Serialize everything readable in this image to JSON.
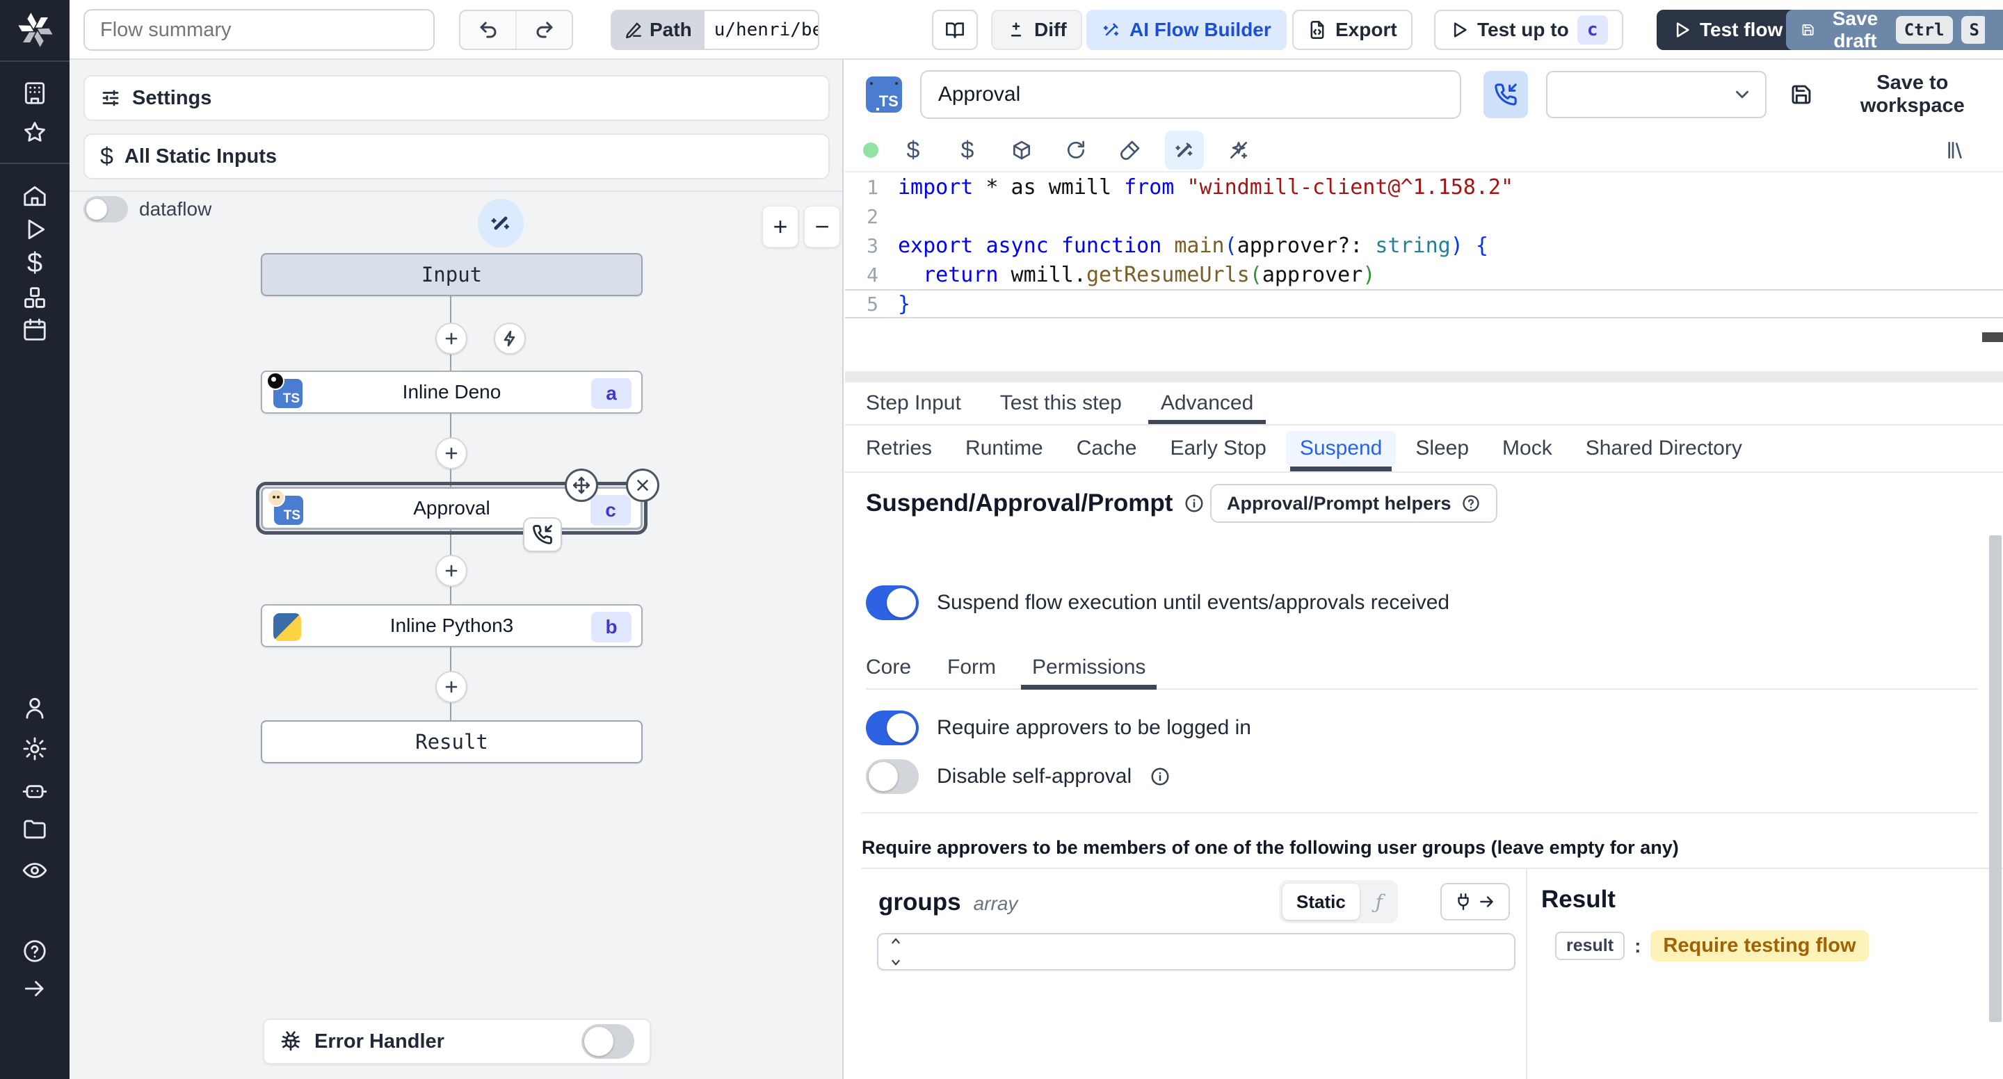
{
  "topbar": {
    "flow_summary_placeholder": "Flow summary",
    "path_label": "Path",
    "path_value": "u/henri/bes",
    "diff_label": "Diff",
    "ai_flow_builder_label": "AI Flow Builder",
    "export_label": "Export",
    "test_up_to_label": "Test up to",
    "test_up_to_badge": "c",
    "test_flow_label": "Test flow",
    "save_draft_label": "Save draft",
    "save_draft_keys": [
      "Ctrl",
      "S"
    ]
  },
  "flow_panel": {
    "settings_label": "Settings",
    "static_inputs_label": "All Static Inputs",
    "dataflow_label": "dataflow",
    "nodes": {
      "input_label": "Input",
      "deno_label": "Inline Deno",
      "deno_badge": "a",
      "approval_label": "Approval",
      "approval_badge": "c",
      "python_label": "Inline Python3",
      "python_badge": "b",
      "result_label": "Result"
    },
    "error_handler_label": "Error Handler"
  },
  "step_editor": {
    "language_badge": "TS",
    "name_value": "Approval",
    "save_to_workspace_label": "Save to workspace",
    "lines": [
      {
        "n": "1",
        "tokens": [
          [
            "kw",
            "import"
          ],
          [
            "pl",
            " * as wmill "
          ],
          [
            "kw",
            "from"
          ],
          [
            "pl",
            " "
          ],
          [
            "str",
            "\"windmill-client@^1.158.2\""
          ]
        ]
      },
      {
        "n": "2",
        "tokens": []
      },
      {
        "n": "3",
        "tokens": [
          [
            "kw",
            "export"
          ],
          [
            "pl",
            " "
          ],
          [
            "kw",
            "async"
          ],
          [
            "pl",
            " "
          ],
          [
            "kw",
            "function"
          ],
          [
            "pl",
            " "
          ],
          [
            "fn",
            "main"
          ],
          [
            "b1",
            "("
          ],
          [
            "pl",
            "approver?: "
          ],
          [
            "ty",
            "string"
          ],
          [
            "b1",
            ")"
          ],
          [
            "pl",
            " "
          ],
          [
            "b1",
            "{"
          ]
        ]
      },
      {
        "n": "4",
        "tokens": [
          [
            "pl",
            "  "
          ],
          [
            "kw",
            "return"
          ],
          [
            "pl",
            " wmill."
          ],
          [
            "fn",
            "getResumeUrls"
          ],
          [
            "b2",
            "("
          ],
          [
            "pl",
            "approver"
          ],
          [
            "b2",
            ")"
          ]
        ]
      },
      {
        "n": "5",
        "tokens": [
          [
            "b1",
            "}"
          ]
        ],
        "current": true
      }
    ]
  },
  "tabs": {
    "main": [
      "Step Input",
      "Test this step",
      "Advanced"
    ],
    "advanced": [
      "Retries",
      "Runtime",
      "Cache",
      "Early Stop",
      "Suspend",
      "Sleep",
      "Mock",
      "Shared Directory"
    ]
  },
  "suspend": {
    "title": "Suspend/Approval/Prompt",
    "helpers_button_label": "Approval/Prompt helpers",
    "suspend_toggle_label": "Suspend flow execution until events/approvals received",
    "sub_tabs": [
      "Core",
      "Form",
      "Permissions"
    ],
    "require_login_label": "Require approvers to be logged in",
    "disable_self_label": "Disable self-approval",
    "groups_note": "Require approvers to be members of one of the following user groups (leave empty for any)"
  },
  "groups_editor": {
    "name": "groups",
    "type": "array",
    "static_label": "Static"
  },
  "result_panel": {
    "title": "Result",
    "key": "result",
    "value": "Require testing flow"
  }
}
